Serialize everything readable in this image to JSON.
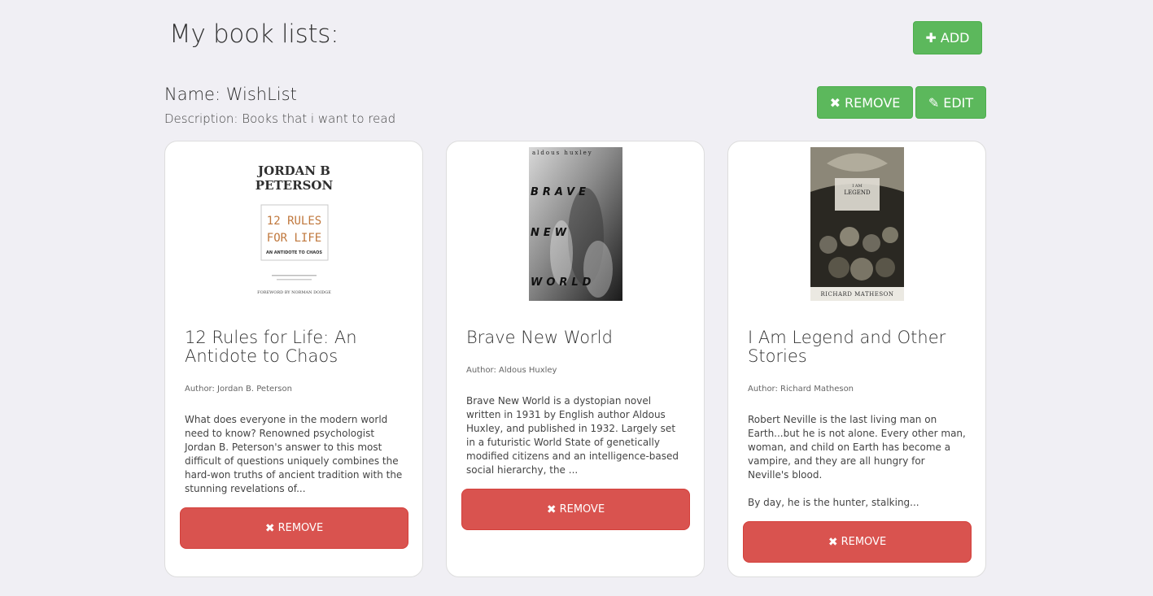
{
  "page": {
    "title": "My book lists:"
  },
  "toolbar": {
    "add_label": "ADD"
  },
  "list": {
    "name": "Name: WishList",
    "description": "Description: Books that i want to read",
    "remove_label": "REMOVE",
    "edit_label": "EDIT"
  },
  "colors": {
    "accent_green": "#5cb85c",
    "danger_red": "#d9534f",
    "background": "#f0eff4"
  },
  "books": [
    {
      "title": "12 Rules for Life: An Antidote to Chaos",
      "author": "Author: Jordan B. Peterson",
      "description": "What does everyone in the modern world need to know? Renowned psychologist Jordan B. Peterson's answer to this most difficult of questions uniquely combines the hard-won truths of ancient tradition with the stunning revelations of...",
      "remove_label": "REMOVE",
      "cover": {
        "line1": "JORDAN B",
        "line2": "PETERSON",
        "line3": "12 RULES",
        "line4": "FOR LIFE",
        "line5": "AN ANTIDOTE TO CHAOS",
        "line6": "FOREWORD BY NORMAN DOIDGE"
      }
    },
    {
      "title": "Brave New World",
      "author": "Author: Aldous Huxley",
      "description": "Brave New World is a dystopian novel written in 1931 by English author Aldous Huxley, and published in 1932. Largely set in a futuristic World State of genetically modified citizens and an intelligence-based social hierarchy, the ...",
      "remove_label": "REMOVE",
      "cover": {
        "line1": "aldous huxley",
        "line2": "BRAVE",
        "line3": "NEW",
        "line4": "WORLD"
      }
    },
    {
      "title": "I Am Legend and Other Stories",
      "author": "Author: Richard Matheson",
      "description": "Robert Neville is the last living man on Earth...but he is not alone. Every other man, woman, and child on Earth has become a vampire, and they are all hungry for Neville's blood.\n\nBy day, he is the hunter, stalking...",
      "remove_label": "REMOVE",
      "cover": {
        "line1": "I AM",
        "line2": "LEGEND",
        "line3": "RICHARD MATHESON"
      }
    }
  ]
}
